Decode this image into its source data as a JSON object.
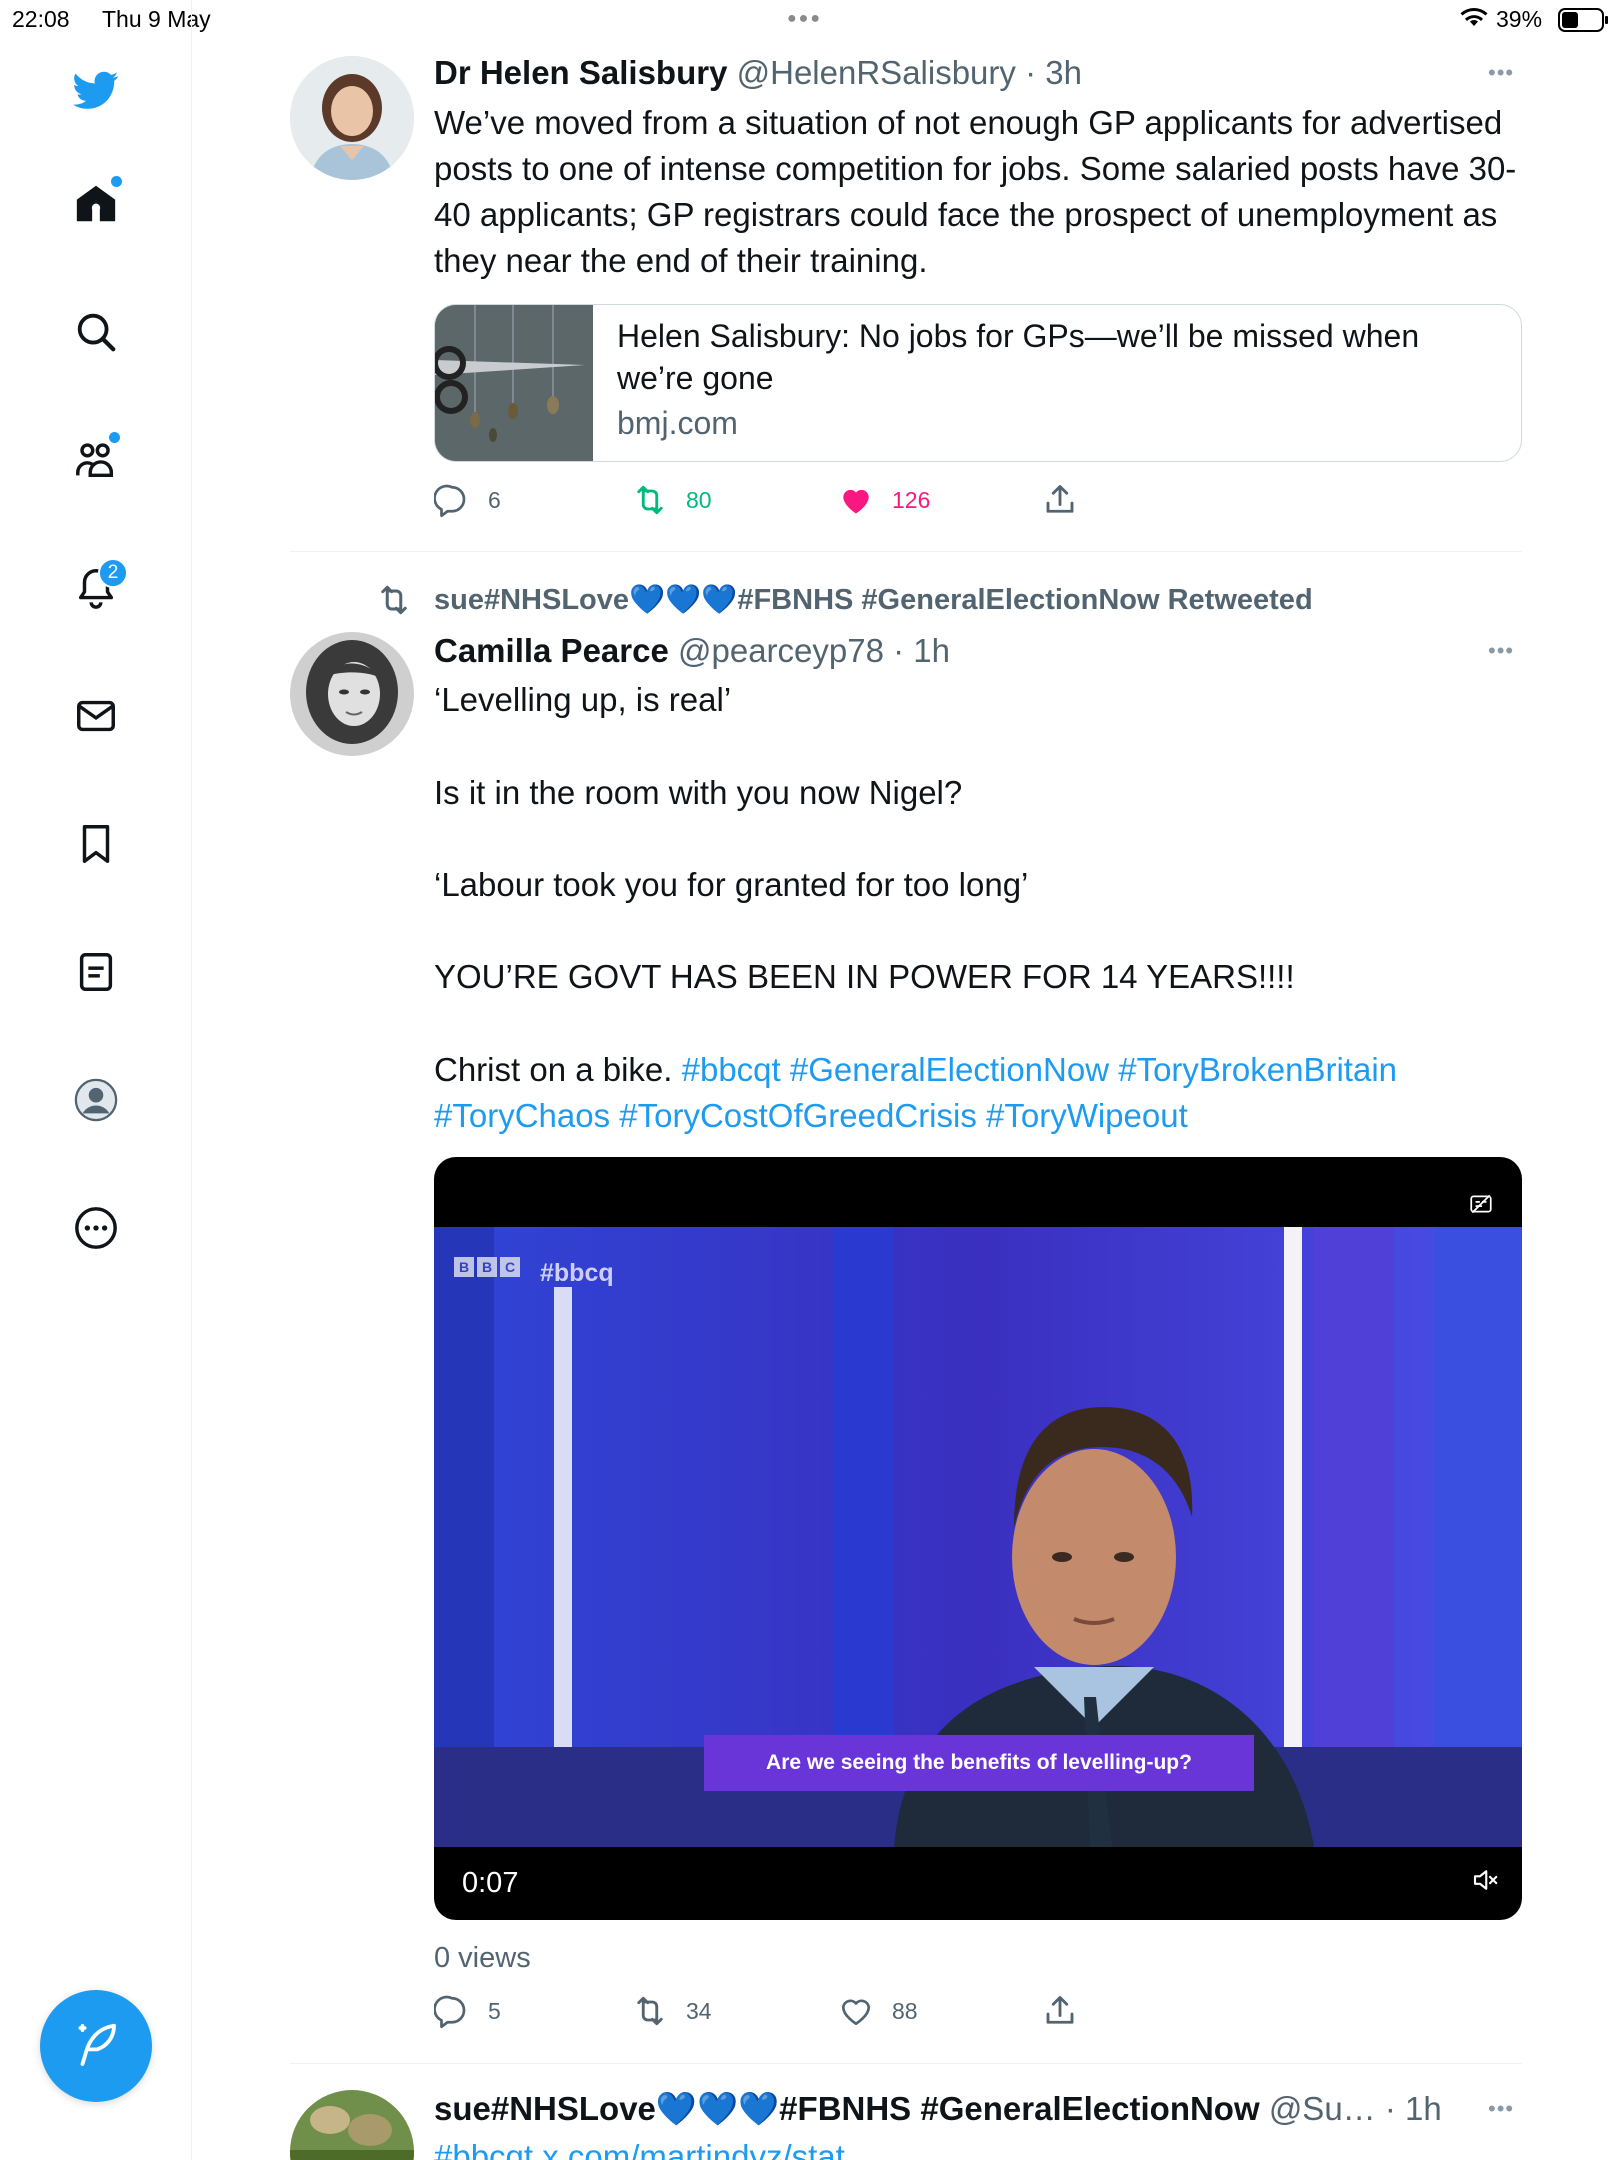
{
  "status_bar": {
    "time": "22:08",
    "date": "Thu 9 May",
    "battery": "39%"
  },
  "sidebar": {
    "items": [
      "home",
      "explore",
      "communities",
      "notifications",
      "messages",
      "bookmarks",
      "lists",
      "profile",
      "more"
    ],
    "notification_count": "2",
    "accent_color": "#1d9bf0"
  },
  "tweets": [
    {
      "name": "Dr Helen Salisbury",
      "handle": "@HelenRSalisbury",
      "time": "· 3h",
      "text": "We’ve moved from a situation of not enough GP applicants for advertised posts to one of intense competition for jobs. Some salaried posts have 30-40 applicants; GP registrars could face the prospect of unemployment as they near the end of their training.",
      "card": {
        "title": "Helen Salisbury: No jobs for GPs—we’ll be missed when we’re gone",
        "domain": "bmj.com"
      },
      "replies": "6",
      "retweets": "80",
      "likes": "126"
    },
    {
      "retweeted_by": "sue#NHSLove💙💙💙#FBNHS #GeneralElectionNow Retweeted",
      "name": "Camilla Pearce",
      "handle": "@pearceyp78",
      "time": "· 1h",
      "lines": [
        "‘Levelling up, is real’",
        "Is it in the room with you now Nigel?",
        "‘Labour took you for granted for too long’",
        "YOU’RE GOVT HAS BEEN IN POWER FOR 14 YEARS!!!!",
        "Christ on a bike."
      ],
      "hashtags_line1": "#bbcqt #GeneralElectionNow #ToryBrokenBritain",
      "hashtags_line2": "#ToryChaos #ToryCostOfGreedCrisis #ToryWipeout",
      "video": {
        "duration": "0:07",
        "caption": "Are we seeing the benefits of levelling-up?",
        "channel_tag": "#bbcq",
        "logo": "BBC"
      },
      "views": "0 views",
      "replies": "5",
      "retweets": "34",
      "likes": "88"
    },
    {
      "name": "sue#NHSLove💙💙💙#FBNHS #GeneralElectionNow",
      "handle": "@Su…",
      "time": "· 1h",
      "text": "#bbcqt x.com/martindyz/stat"
    }
  ]
}
